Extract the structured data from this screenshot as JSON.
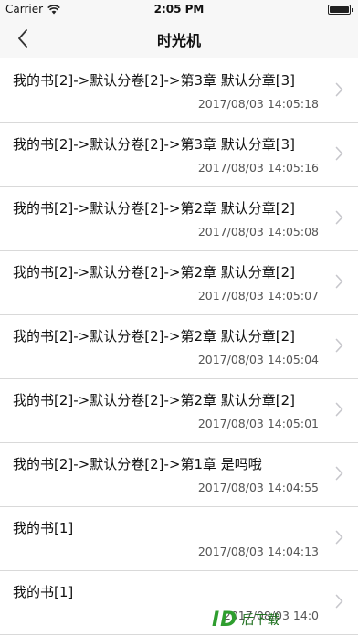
{
  "status_bar": {
    "carrier": "Carrier",
    "time": "2:05 PM",
    "icons": [
      "wifi-icon",
      "battery-icon"
    ]
  },
  "nav": {
    "title": "时光机",
    "back_icon": "chevron-left-icon"
  },
  "items": [
    {
      "title": "我的书[2]->默认分卷[2]->第3章 默认分章[3]",
      "time": "2017/08/03 14:05:18"
    },
    {
      "title": "我的书[2]->默认分卷[2]->第3章 默认分章[3]",
      "time": "2017/08/03 14:05:16"
    },
    {
      "title": "我的书[2]->默认分卷[2]->第2章 默认分章[2]",
      "time": "2017/08/03 14:05:08"
    },
    {
      "title": "我的书[2]->默认分卷[2]->第2章 默认分章[2]",
      "time": "2017/08/03 14:05:07"
    },
    {
      "title": "我的书[2]->默认分卷[2]->第2章 默认分章[2]",
      "time": "2017/08/03 14:05:04"
    },
    {
      "title": "我的书[2]->默认分卷[2]->第2章 默认分章[2]",
      "time": "2017/08/03 14:05:01"
    },
    {
      "title": "我的书[2]->默认分卷[2]->第1章 是吗哦",
      "time": "2017/08/03 14:04:55"
    },
    {
      "title": "我的书[1]",
      "time": "2017/08/03 14:04:13"
    },
    {
      "title": "我的书[1]",
      "time": "2017/08/03 14:0"
    }
  ],
  "watermark": {
    "logo": "ID",
    "text": "后下载"
  },
  "colors": {
    "chevron": "#c7c7cc",
    "separator": "#d9d9d9",
    "bar": "#f7f7f7"
  }
}
